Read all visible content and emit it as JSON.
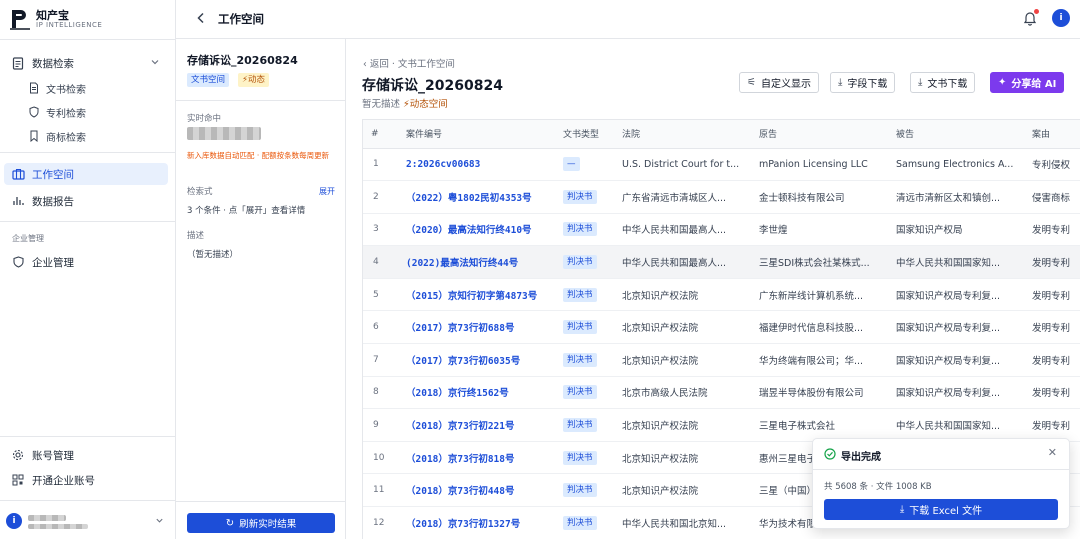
{
  "brand": {
    "name": "知产宝",
    "subtitle": "IP INTELLIGENCE"
  },
  "sidebar": {
    "groups": [
      {
        "label": "数据检索",
        "icon": "document-search-icon"
      }
    ],
    "sub_items": [
      {
        "label": "文书检索",
        "icon": "file-icon"
      },
      {
        "label": "专利检索",
        "icon": "shield-icon"
      },
      {
        "label": "商标检索",
        "icon": "bookmark-icon"
      }
    ],
    "workspace": {
      "label": "工作空间",
      "icon": "briefcase-icon"
    },
    "report": {
      "label": "数据报告",
      "icon": "bar-chart-icon"
    },
    "section_enterprise": "企业管理",
    "enterprise": {
      "label": "企业管理",
      "icon": "shield-icon"
    },
    "account": {
      "label": "账号管理",
      "icon": "gear-icon"
    },
    "open_enterprise": {
      "label": "开通企业账号",
      "icon": "qr-icon"
    },
    "user_avatar": "i"
  },
  "header": {
    "title": "工作空间",
    "avatar": "i"
  },
  "panel": {
    "title": "存储诉讼_20260824",
    "tag_workspace": "文书空间",
    "tag_dynamic": "⚡动态",
    "realtime_label": "实时命中",
    "warning": "新入库数据自动匹配 · 配额按条数每周更新",
    "search_label": "检索式",
    "expand": "展开",
    "search_summary": "3 个条件 · 点「展开」查看详情",
    "desc_label": "描述",
    "desc_value": "（暂无描述）",
    "refresh": "刷新实时结果"
  },
  "main": {
    "crumb_back": "‹ 返回",
    "crumb_sep": " · ",
    "crumb_current": "文书工作空间",
    "title": "存储诉讼_20260824",
    "desc_prefix": "暂无描述",
    "desc_dynamic": "⚡动态空间",
    "buttons": {
      "custom": "自定义显示",
      "field_download": "字段下载",
      "doc_download": "文书下载",
      "share_ai": "分享给 AI"
    }
  },
  "table": {
    "columns": [
      "#",
      "案件编号",
      "文书类型",
      "法院",
      "原告",
      "被告",
      "案由"
    ],
    "rows": [
      {
        "idx": "1",
        "case": "2:2026cv00683",
        "type": "—",
        "court": "U.S. District Court for t...",
        "plaintiff": "mPanion Licensing LLC",
        "defendant": "Samsung Electronics A...",
        "cause": "专利侵权"
      },
      {
        "idx": "2",
        "case": "（2022）粤1802民初4353号",
        "type": "判决书",
        "court": "广东省清远市清城区人...",
        "plaintiff": "金士顿科技有限公司",
        "defendant": "清远市清新区太和镇创...",
        "cause": "侵害商标"
      },
      {
        "idx": "3",
        "case": "（2020）最高法知行终410号",
        "type": "判决书",
        "court": "中华人民共和国最高人...",
        "plaintiff": "李世煌",
        "defendant": "国家知识产权局",
        "cause": "发明专利"
      },
      {
        "idx": "4",
        "case": "(2022)最高法知行终44号",
        "type": "判决书",
        "court": "中华人民共和国最高人...",
        "plaintiff": "三星SDI株式会社某株式...",
        "defendant": "中华人民共和国国家知...",
        "cause": "发明专利"
      },
      {
        "idx": "5",
        "case": "（2015）京知行初字第4873号",
        "type": "判决书",
        "court": "北京知识产权法院",
        "plaintiff": "广东新岸线计算机系统...",
        "defendant": "国家知识产权局专利复...",
        "cause": "发明专利"
      },
      {
        "idx": "6",
        "case": "（2017）京73行初688号",
        "type": "判决书",
        "court": "北京知识产权法院",
        "plaintiff": "福建伊时代信息科技股...",
        "defendant": "国家知识产权局专利复...",
        "cause": "发明专利"
      },
      {
        "idx": "7",
        "case": "（2017）京73行初6035号",
        "type": "判决书",
        "court": "北京知识产权法院",
        "plaintiff": "华为终端有限公司；华...",
        "defendant": "国家知识产权局专利复...",
        "cause": "发明专利"
      },
      {
        "idx": "8",
        "case": "（2018）京行终1562号",
        "type": "判决书",
        "court": "北京市高级人民法院",
        "plaintiff": "瑞昱半导体股份有限公司",
        "defendant": "国家知识产权局专利复...",
        "cause": "发明专利"
      },
      {
        "idx": "9",
        "case": "（2018）京73行初221号",
        "type": "判决书",
        "court": "北京知识产权法院",
        "plaintiff": "三星电子株式会社",
        "defendant": "中华人民共和国国家知...",
        "cause": "发明专利"
      },
      {
        "idx": "10",
        "case": "（2018）京73行初818号",
        "type": "判决书",
        "court": "北京知识产权法院",
        "plaintiff": "惠州三星电子...",
        "defendant": "",
        "cause": ""
      },
      {
        "idx": "11",
        "case": "（2018）京73行初448号",
        "type": "判决书",
        "court": "北京知识产权法院",
        "plaintiff": "三星（中国）...",
        "defendant": "",
        "cause": ""
      },
      {
        "idx": "12",
        "case": "（2018）京73行初1327号",
        "type": "判决书",
        "court": "中华人民共和国北京知...",
        "plaintiff": "华为技术有限...",
        "defendant": "",
        "cause": ""
      }
    ]
  },
  "toast": {
    "title": "导出完成",
    "info": "共 5608 条 · 文件 1008 KB",
    "button": "下载 Excel 文件"
  },
  "colors": {
    "primary": "#1d4ed8",
    "ai": "#7c3aed",
    "warning": "#ea580c",
    "success": "#16a34a"
  }
}
